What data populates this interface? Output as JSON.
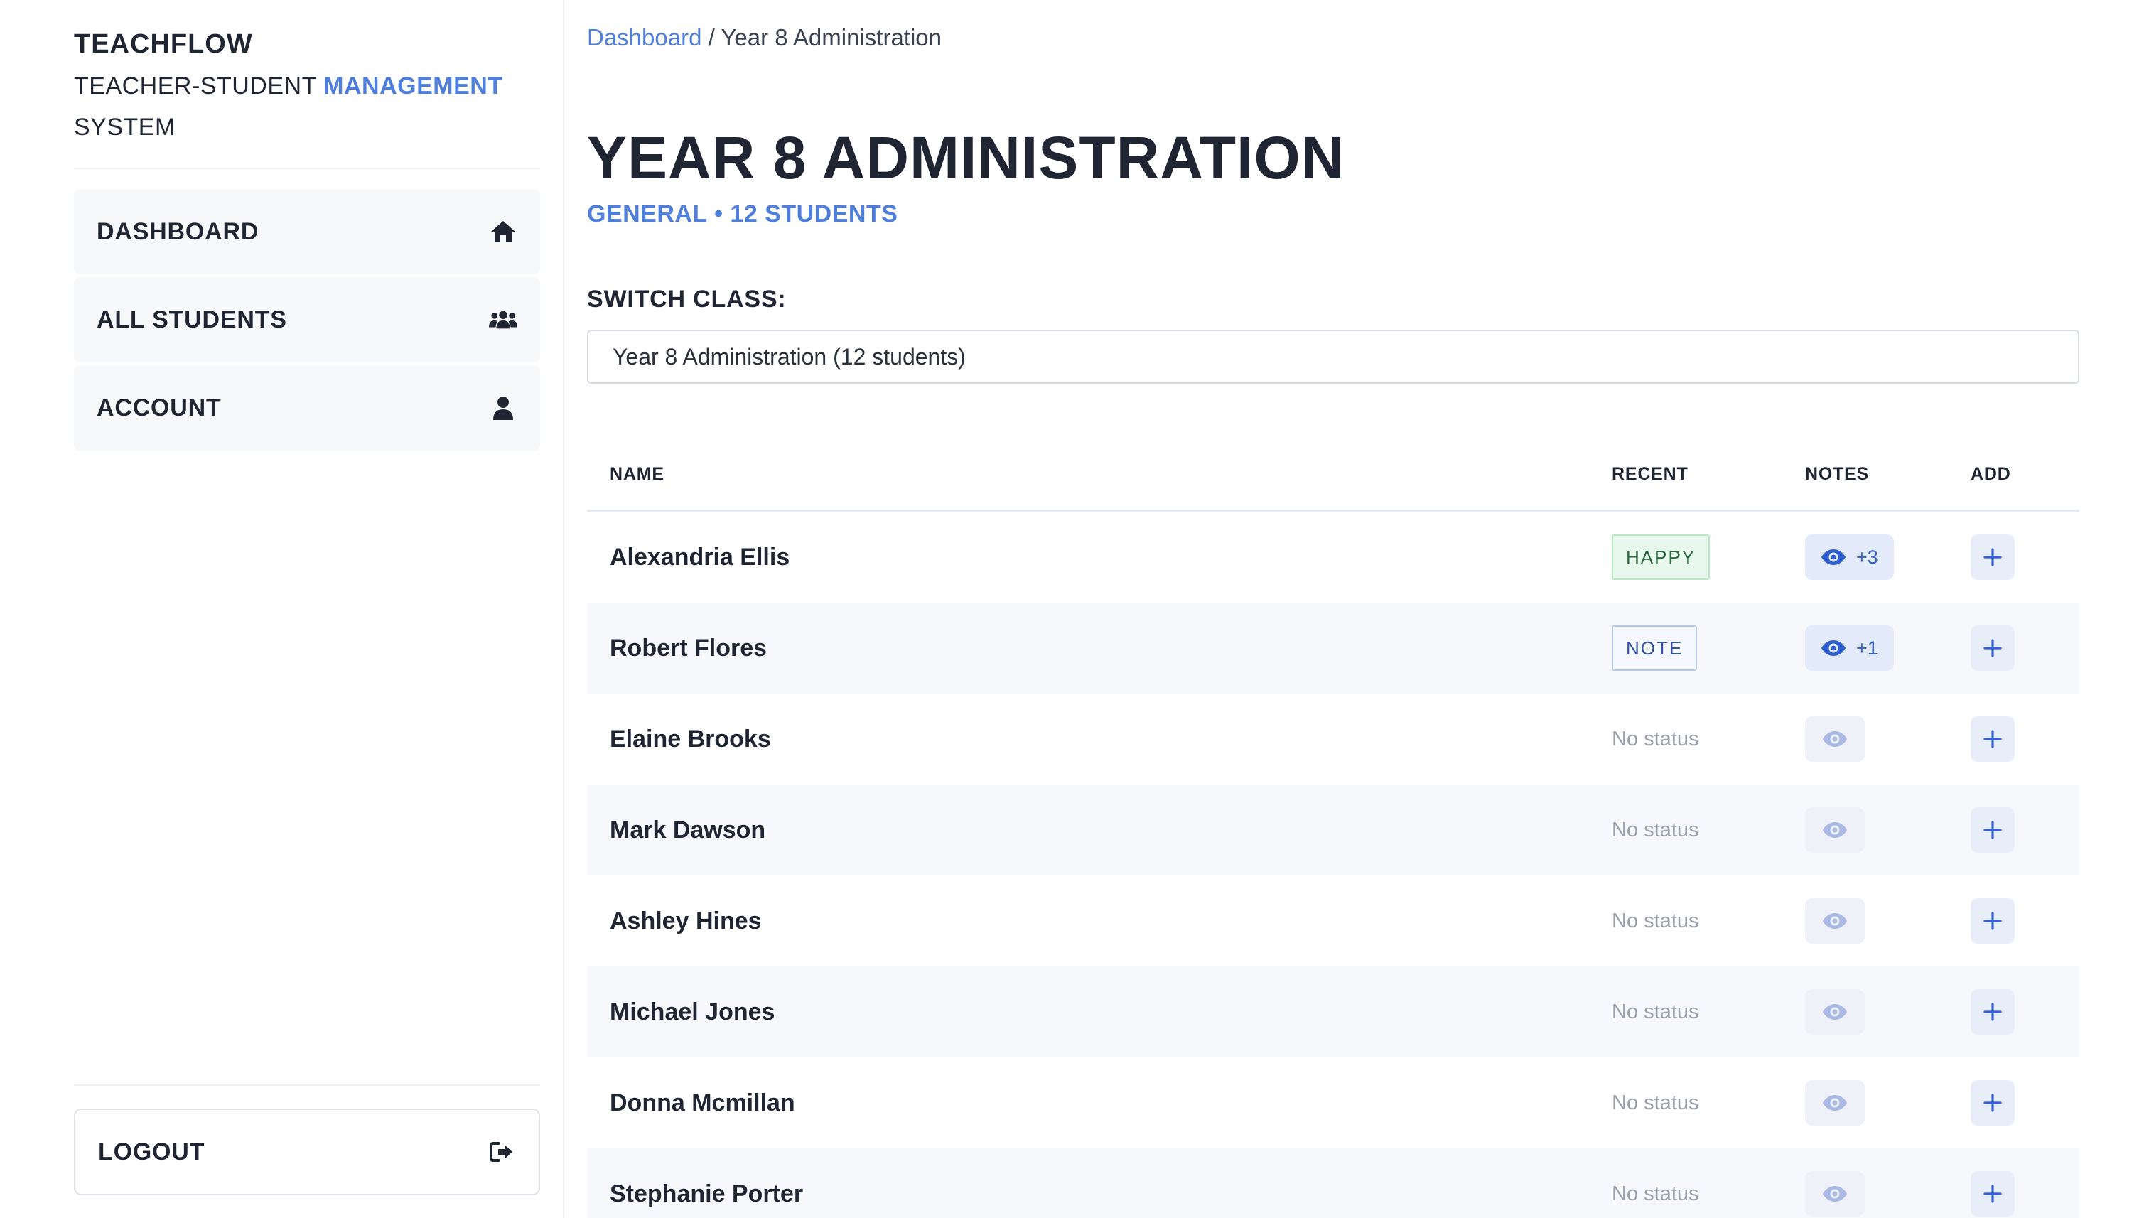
{
  "brand": {
    "title": "TEACHFLOW",
    "subtitle_prefix": "TEACHER-STUDENT ",
    "subtitle_accent": "MANAGEMENT",
    "subtitle_suffix": "SYSTEM"
  },
  "nav": {
    "items": [
      {
        "label": "DASHBOARD",
        "icon": "home-icon"
      },
      {
        "label": "ALL STUDENTS",
        "icon": "users-icon"
      },
      {
        "label": "ACCOUNT",
        "icon": "user-icon"
      }
    ],
    "logout_label": "LOGOUT",
    "logout_icon": "logout-icon"
  },
  "breadcrumb": {
    "link": "Dashboard",
    "separator": "/",
    "current": "Year 8 Administration"
  },
  "page": {
    "title": "YEAR 8 ADMINISTRATION",
    "subtitle": "GENERAL • 12 STUDENTS",
    "switch_label": "SWITCH CLASS:",
    "switch_value": "Year 8 Administration (12 students)"
  },
  "table": {
    "headers": {
      "name": "NAME",
      "recent": "RECENT",
      "notes": "NOTES",
      "add": "ADD"
    },
    "rows": [
      {
        "name": "Alexandria Ellis",
        "recent": "HAPPY",
        "recent_type": "happy",
        "notes": "+3"
      },
      {
        "name": "Robert Flores",
        "recent": "NOTE",
        "recent_type": "note",
        "notes": "+1"
      },
      {
        "name": "Elaine Brooks",
        "recent": "No status",
        "recent_type": "none",
        "notes": ""
      },
      {
        "name": "Mark Dawson",
        "recent": "No status",
        "recent_type": "none",
        "notes": ""
      },
      {
        "name": "Ashley Hines",
        "recent": "No status",
        "recent_type": "none",
        "notes": ""
      },
      {
        "name": "Michael Jones",
        "recent": "No status",
        "recent_type": "none",
        "notes": ""
      },
      {
        "name": "Donna Mcmillan",
        "recent": "No status",
        "recent_type": "none",
        "notes": ""
      },
      {
        "name": "Stephanie Porter",
        "recent": "No status",
        "recent_type": "none",
        "notes": ""
      }
    ]
  },
  "colors": {
    "accent": "#4f7fdc",
    "text": "#1f2533",
    "happy_bg": "#e8f8ec",
    "note_border": "#b9c9ee"
  }
}
